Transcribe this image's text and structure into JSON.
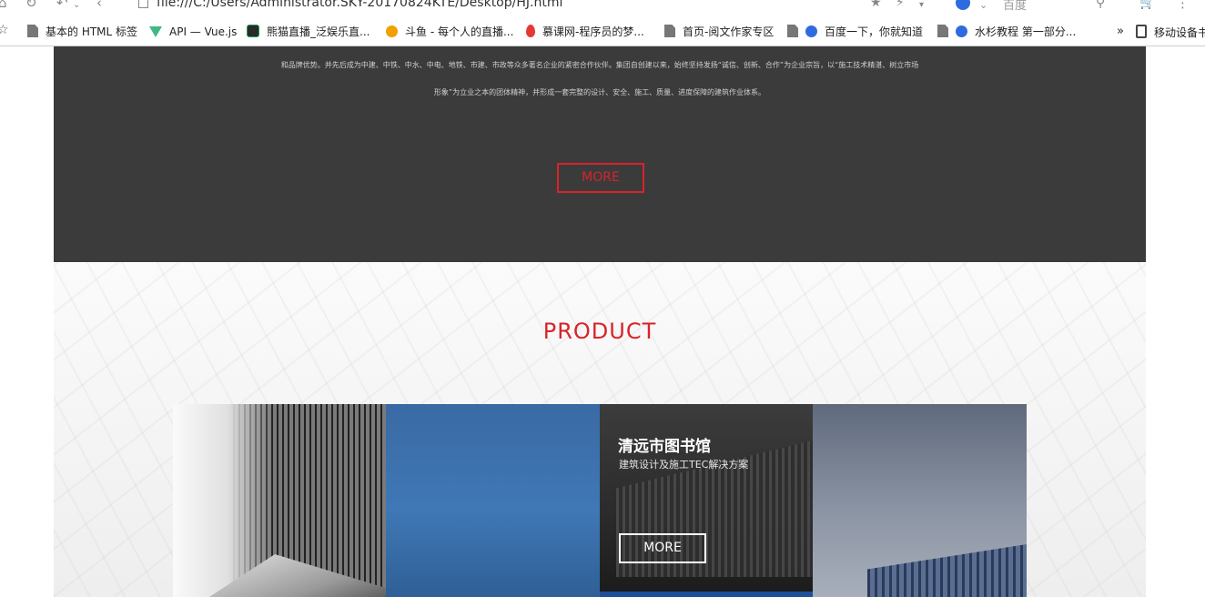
{
  "browser": {
    "url": "file:///C:/Users/Administrator.SKY-20170824KTE/Desktop/HJ.html",
    "search_engine": "百度",
    "bookmarks": [
      {
        "label": "基本的 HTML 标签",
        "icon": "page-icon"
      },
      {
        "label": "API — Vue.js",
        "icon": "vue-icon"
      },
      {
        "label": "熊猫直播_泛娱乐直...",
        "icon": "panda-icon"
      },
      {
        "label": "斗鱼 - 每个人的直播...",
        "icon": "douyu-icon"
      },
      {
        "label": "慕课网-程序员的梦...",
        "icon": "mooc-icon"
      },
      {
        "label": "首页-阅文作家专区",
        "icon": "page-icon"
      },
      {
        "label": "百度一下，你就知道",
        "icon": "baidu-icon"
      },
      {
        "label": "水杉教程 第一部分...",
        "icon": "baidu-icon"
      },
      {
        "label": "移动设备书",
        "icon": "device-icon"
      }
    ],
    "overflow_label": "»"
  },
  "intro": {
    "line1": "和品牌优势。并先后成为中建、中铁、中水、中电、地铁、市建、市政等众多著名企业的紧密合作伙伴。集团自创建以来，始终坚持发扬“诚信、创新、合作”为企业宗旨，以“施工技术精湛、树立市场",
    "line2": "形象”为立业之本的团体精神，并形成一套完整的设计、安全、施工、质量、进度保障的建筑作业体系。",
    "more_label": "MORE"
  },
  "product": {
    "title": "PRODUCT",
    "featured": {
      "title": "清远市图书馆",
      "subtitle": "建筑设计及施工TEC解决方案",
      "more_label": "MORE"
    }
  },
  "colors": {
    "accent_red": "#d9232a",
    "dark_section": "#3b3b3b"
  }
}
